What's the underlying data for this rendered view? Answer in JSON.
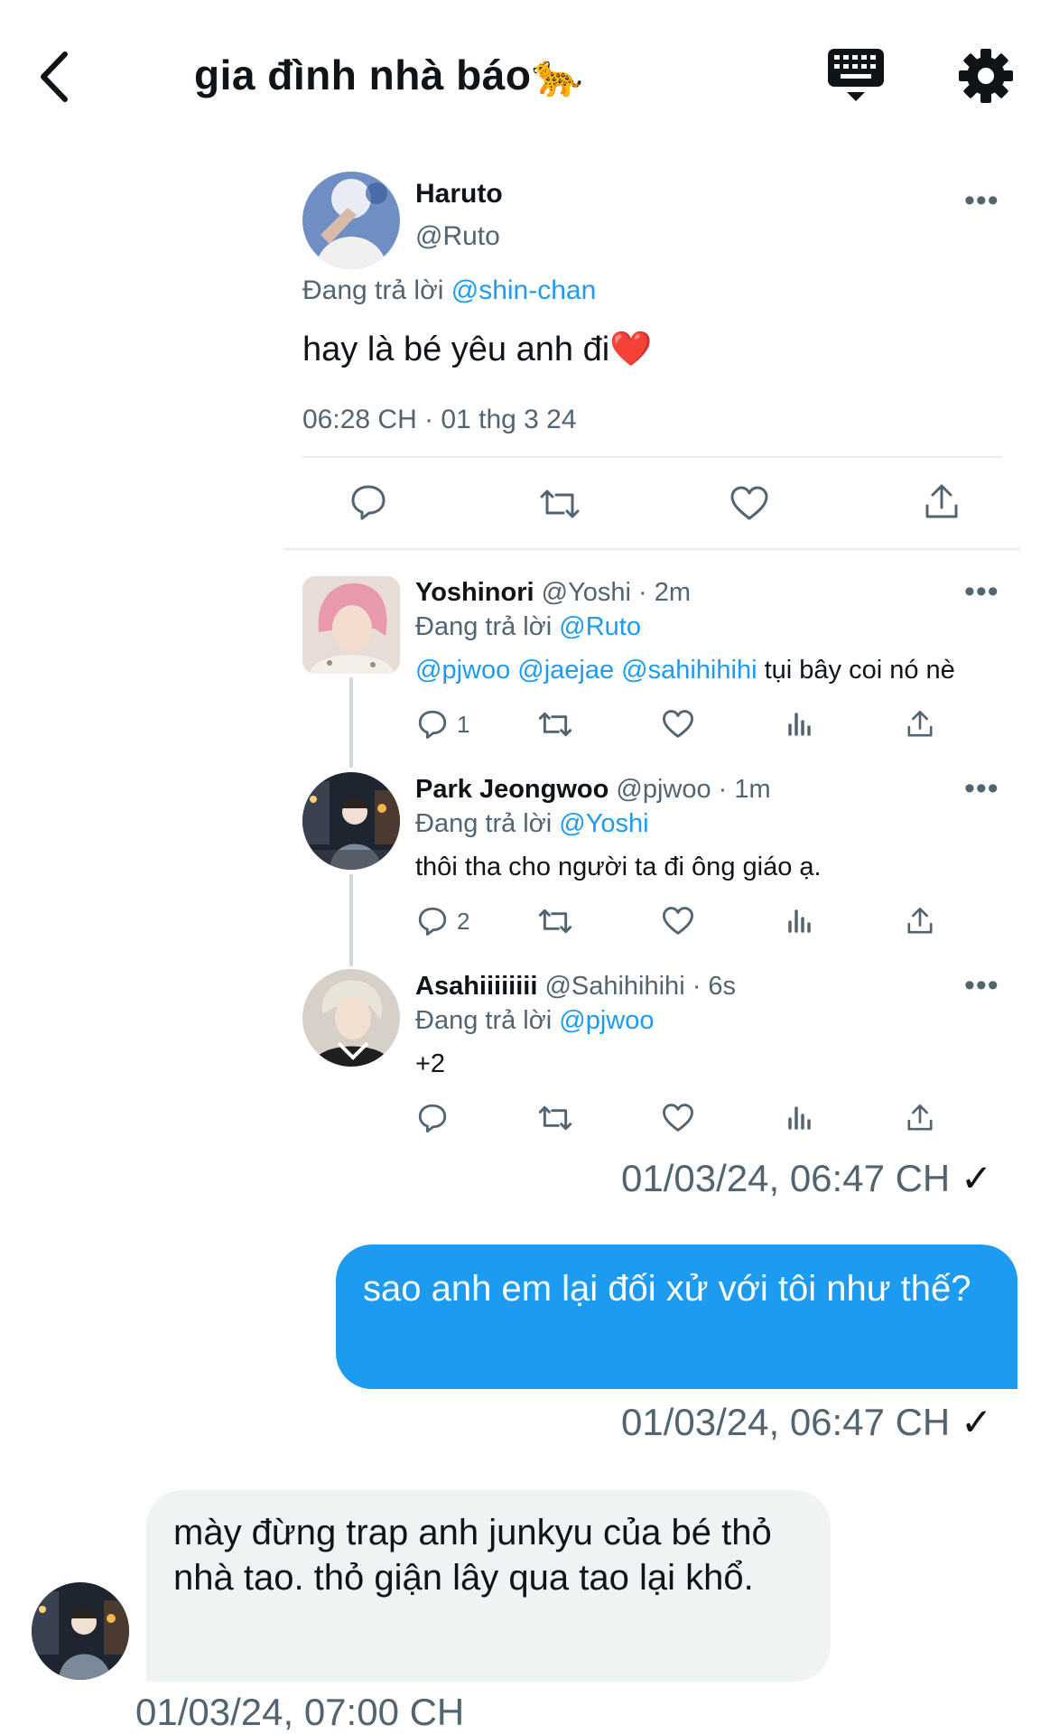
{
  "header": {
    "title": "gia đình nhà báo🐆"
  },
  "quoted_tweet": {
    "name": "Haruto",
    "handle": "@Ruto",
    "reply_prefix": "Đang trả lời",
    "reply_to": "@shin-chan",
    "text": "hay là bé yêu anh đi❤️",
    "timestamp": "06:28 CH · 01 thg 3 24",
    "more": "•••"
  },
  "replies": [
    {
      "name": "Yoshinori",
      "meta": "@Yoshi · 2m",
      "reply_prefix": "Đang trả lời",
      "reply_to": "@Ruto",
      "mentions": "@pjwoo @jaejae @sahihihihi",
      "text": " tụi bây coi nó nè",
      "reply_count": "1",
      "more": "•••"
    },
    {
      "name": "Park Jeongwoo",
      "meta": "@pjwoo · 1m",
      "reply_prefix": "Đang trả lời",
      "reply_to": "@Yoshi",
      "text": "thôi tha cho người ta đi ông giáo ạ.",
      "reply_count": "2",
      "more": "•••"
    },
    {
      "name": "Asahiiiiiiii",
      "meta": "@Sahihihihi · 6s",
      "reply_prefix": "Đang trả lời",
      "reply_to": "@pjwoo",
      "text": "+2",
      "reply_count": "",
      "more": "•••"
    }
  ],
  "messages": [
    {
      "type": "shared",
      "timestamp": "01/03/24, 06:47 CH",
      "check": "✓"
    },
    {
      "type": "outgoing",
      "text": "sao anh em lại đối xử với tôi như thế?",
      "timestamp": "01/03/24, 06:47 CH",
      "check": "✓"
    },
    {
      "type": "incoming",
      "text": "mày đừng trap anh junkyu của bé thỏ nhà tao. thỏ giận lây qua tao lại khổ.",
      "timestamp": "01/03/24, 07:00 CH"
    }
  ],
  "colors": {
    "accent": "#1d9bf0",
    "muted": "#536471",
    "bubble_in": "#eff3f4"
  }
}
